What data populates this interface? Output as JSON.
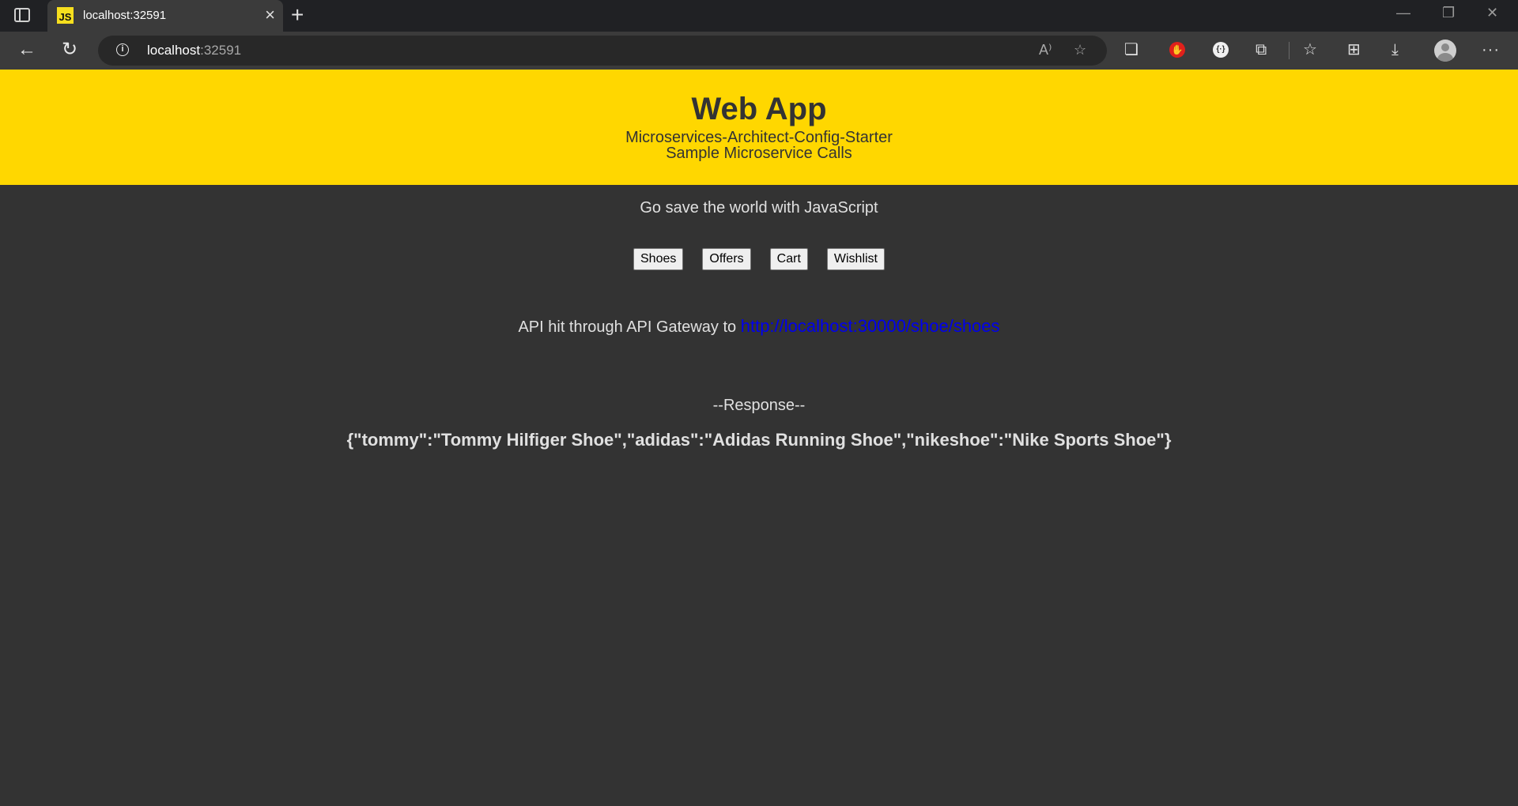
{
  "browser": {
    "tab_title": "localhost:32591",
    "favicon_text": "JS",
    "address_host": "localhost",
    "address_port": ":32591",
    "icons": [
      "sidebar-icon",
      "close-icon",
      "new-tab-icon",
      "minimize-icon",
      "restore-icon",
      "window-close-icon",
      "back-icon",
      "refresh-icon",
      "site-info-icon",
      "read-aloud-icon",
      "add-favorite-icon",
      "copy-icon",
      "adblock-icon",
      "extension-icon",
      "extensions-icon",
      "favorites-icon",
      "collections-icon",
      "downloads-icon",
      "profile-avatar",
      "more-icon"
    ]
  },
  "header": {
    "title": "Web App",
    "subtitle1": "Microservices-Architect-Config-Starter",
    "subtitle2": "Sample Microservice Calls",
    "background_color": "#ffd700"
  },
  "main": {
    "tagline": "Go save the world with JavaScript",
    "buttons": [
      "Shoes",
      "Offers",
      "Cart",
      "Wishlist"
    ],
    "api_prefix": "API hit through API Gateway to ",
    "api_url": "http://localhost:30000/shoe/shoes",
    "response_heading": "--Response--",
    "response_body": "{\"tommy\":\"Tommy Hilfiger Shoe\",\"adidas\":\"Adidas Running Shoe\",\"nikeshoe\":\"Nike Sports Shoe\"}",
    "background_color": "#333333",
    "link_color": "#0000ee"
  }
}
